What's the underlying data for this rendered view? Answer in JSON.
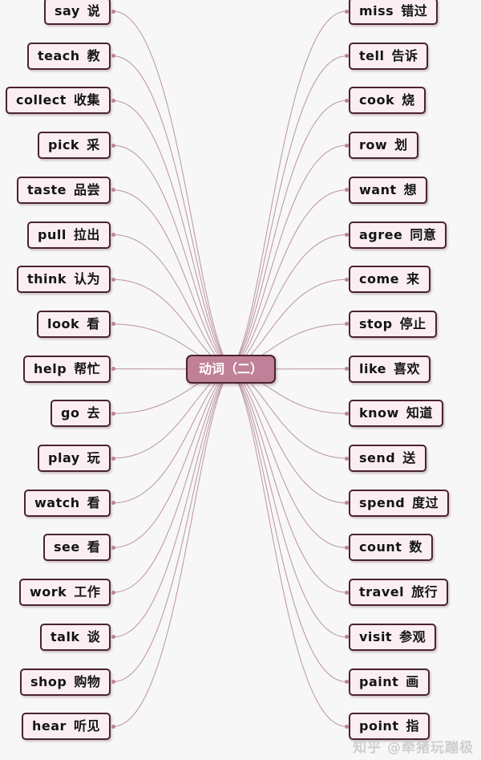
{
  "center": {
    "label": "动词（二）"
  },
  "watermark": {
    "text": "知乎 @牵猪玩蹦极"
  },
  "colors": {
    "background": "#f7f7f7",
    "node_fill": "#faeef2",
    "node_border": "#4a2230",
    "center_fill": "#c08098",
    "center_text": "#ffffff",
    "connector": "#b0818f",
    "node_text": "#141414",
    "watermark_text": "#cfcfcf"
  },
  "left_branches": [
    {
      "en": "say",
      "zh": "说"
    },
    {
      "en": "teach",
      "zh": "教"
    },
    {
      "en": "collect",
      "zh": "收集"
    },
    {
      "en": "pick",
      "zh": "采"
    },
    {
      "en": "taste",
      "zh": "品尝"
    },
    {
      "en": "pull",
      "zh": "拉出"
    },
    {
      "en": "think",
      "zh": "认为"
    },
    {
      "en": "look",
      "zh": "看"
    },
    {
      "en": "help",
      "zh": "帮忙"
    },
    {
      "en": "go",
      "zh": "去"
    },
    {
      "en": "play",
      "zh": "玩"
    },
    {
      "en": "watch",
      "zh": "看"
    },
    {
      "en": "see",
      "zh": "看"
    },
    {
      "en": "work",
      "zh": "工作"
    },
    {
      "en": "talk",
      "zh": "谈"
    },
    {
      "en": "shop",
      "zh": "购物"
    },
    {
      "en": "hear",
      "zh": "听见"
    }
  ],
  "right_branches": [
    {
      "en": "miss",
      "zh": "错过"
    },
    {
      "en": "tell",
      "zh": "告诉"
    },
    {
      "en": "cook",
      "zh": "烧"
    },
    {
      "en": "row",
      "zh": "划"
    },
    {
      "en": "want",
      "zh": "想"
    },
    {
      "en": "agree",
      "zh": "同意"
    },
    {
      "en": "come",
      "zh": "来"
    },
    {
      "en": "stop",
      "zh": "停止"
    },
    {
      "en": "like",
      "zh": "喜欢"
    },
    {
      "en": "know",
      "zh": "知道"
    },
    {
      "en": "send",
      "zh": "送"
    },
    {
      "en": "spend",
      "zh": "度过"
    },
    {
      "en": "count",
      "zh": "数"
    },
    {
      "en": "travel",
      "zh": "旅行"
    },
    {
      "en": "visit",
      "zh": "参观"
    },
    {
      "en": "paint",
      "zh": "画"
    },
    {
      "en": "point",
      "zh": "指"
    }
  ]
}
